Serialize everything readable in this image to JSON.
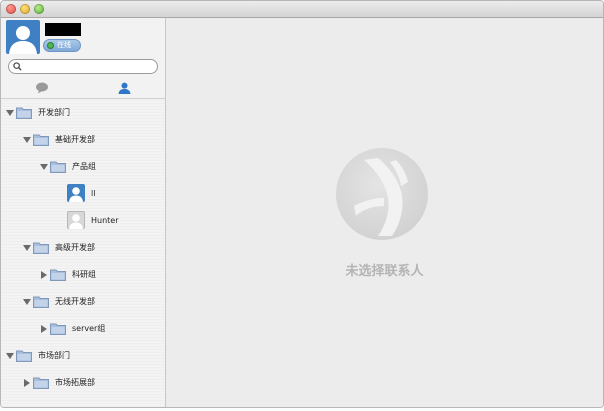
{
  "user": {
    "status": "在线"
  },
  "search": {
    "placeholder": ""
  },
  "tree": {
    "dept_dev": "开发部门",
    "basic_dev": "基础开发部",
    "product_group": "产品组",
    "contact_ll": "ll",
    "contact_hunter": "Hunter",
    "advanced_dev": "高级开发部",
    "research_group": "科研组",
    "wireless_dev": "无线开发部",
    "server_group": "server组",
    "dept_market": "市场部门",
    "market_expansion": "市场拓展部"
  },
  "main": {
    "empty_text": "未选择联系人"
  },
  "colors": {
    "accent": "#2f76c7",
    "folder": "#9bb2d2",
    "empty_text": "#b4b4b4"
  }
}
